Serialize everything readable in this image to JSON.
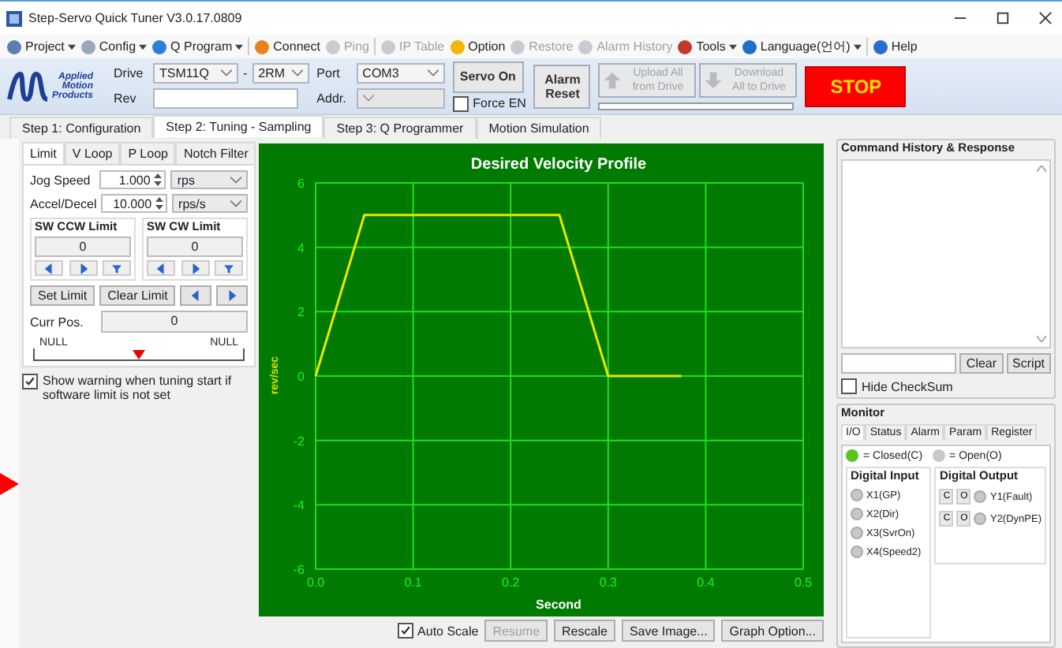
{
  "window": {
    "title": "Step-Servo Quick Tuner V3.0.17.0809"
  },
  "menu": [
    {
      "label": "Project",
      "dropdown": true,
      "disabled": false
    },
    {
      "label": "Config",
      "dropdown": true,
      "disabled": false
    },
    {
      "label": "Q Program",
      "dropdown": true,
      "disabled": false
    },
    {
      "label": "Connect",
      "dropdown": false,
      "disabled": false
    },
    {
      "label": "Ping",
      "dropdown": false,
      "disabled": true
    },
    {
      "label": "IP Table",
      "dropdown": false,
      "disabled": true
    },
    {
      "label": "Option",
      "dropdown": false,
      "disabled": false
    },
    {
      "label": "Restore",
      "dropdown": false,
      "disabled": true
    },
    {
      "label": "Alarm History",
      "dropdown": false,
      "disabled": true
    },
    {
      "label": "Tools",
      "dropdown": true,
      "disabled": false
    },
    {
      "label": "Language(언어)",
      "dropdown": true,
      "disabled": false
    },
    {
      "label": "Help",
      "dropdown": false,
      "disabled": false
    }
  ],
  "ribbon": {
    "logo": [
      "Applied",
      "Motion",
      "Products"
    ],
    "drive_label": "Drive",
    "drive": "TSM11Q",
    "dash": "-",
    "drive_option": "2RM",
    "rev_label": "Rev",
    "port_label": "Port",
    "port": "COM3",
    "addr_label": "Addr.",
    "servo_on": "Servo On",
    "force_en": {
      "label": "Force EN",
      "checked": false
    },
    "alarm_reset": [
      "Alarm",
      "Reset"
    ],
    "upload": {
      "label": [
        "Upload All",
        "from Drive"
      ],
      "disabled": true
    },
    "download": {
      "label": [
        "Download",
        "All to Drive"
      ],
      "disabled": true
    },
    "progress": {
      "level": 0
    },
    "stop": "STOP"
  },
  "tabs": [
    {
      "label": "Step 1: Configuration",
      "selected": false
    },
    {
      "label": "Step 2: Tuning - Sampling",
      "selected": true
    },
    {
      "label": "Step 3: Q Programmer",
      "selected": false
    },
    {
      "label": "Motion Simulation",
      "selected": false
    }
  ],
  "left": {
    "tabs": [
      {
        "label": "Limit",
        "selected": true
      },
      {
        "label": "V Loop",
        "selected": false
      },
      {
        "label": "P Loop",
        "selected": false
      },
      {
        "label": "Notch Filter",
        "selected": false
      }
    ],
    "jog_speed": {
      "label": "Jog Speed",
      "value": "1.000",
      "unit": "rps"
    },
    "accel": {
      "label": "Accel/Decel",
      "value": "10.000",
      "unit": "rps/s"
    },
    "limits": [
      {
        "title": "SW CCW Limit",
        "value": "0"
      },
      {
        "title": "SW CW Limit",
        "value": "0"
      }
    ],
    "set_limit": "Set Limit",
    "clear_limit": "Clear Limit",
    "curr_pos": {
      "label": "Curr Pos.",
      "value": "0"
    },
    "scale": {
      "left": "NULL",
      "right": "NULL",
      "level": 0.5
    },
    "warning": {
      "label": "Show warning when tuning start if software limit is not set",
      "checked": true
    }
  },
  "chart": {
    "chart_data": {
      "type": "line",
      "title": "Desired Velocity Profile",
      "xlabel": "Second",
      "ylabel": "rev/sec",
      "x": [
        0,
        0.05,
        0.25,
        0.3,
        0.375
      ],
      "grid": true,
      "series": [
        {
          "color": "#e8e800",
          "values": [
            0,
            5,
            5,
            0,
            0
          ]
        }
      ],
      "xlim": [
        0,
        0.5
      ],
      "ylim": [
        -6,
        6
      ],
      "xticks": [
        {
          "value": 0,
          "label": "0.0"
        },
        {
          "value": 0.1,
          "label": "0.1"
        },
        {
          "value": 0.2,
          "label": "0.2"
        },
        {
          "value": 0.3,
          "label": "0.3"
        },
        {
          "value": 0.4,
          "label": "0.4"
        },
        {
          "value": 0.5,
          "label": "0.5"
        }
      ],
      "yticks": [
        -6,
        -4,
        -2,
        0,
        2,
        4,
        6
      ]
    },
    "auto_scale": {
      "label": "Auto Scale",
      "checked": true
    },
    "buttons": [
      {
        "label": "Resume",
        "disabled": true
      },
      {
        "label": "Rescale",
        "disabled": false
      },
      {
        "label": "Save Image...",
        "disabled": false
      },
      {
        "label": "Graph Option...",
        "disabled": false
      }
    ]
  },
  "command": {
    "title": "Command History & Response",
    "clear": "Clear",
    "script": "Script",
    "hide_checksum": {
      "label": "Hide CheckSum",
      "checked": false
    }
  },
  "monitor": {
    "title": "Monitor",
    "tabs": [
      {
        "label": "I/O",
        "selected": true
      },
      {
        "label": "Status",
        "selected": false
      },
      {
        "label": "Alarm",
        "selected": false
      },
      {
        "label": "Param",
        "selected": false
      },
      {
        "label": "Register",
        "selected": false
      }
    ],
    "legend": [
      {
        "label": "= Closed(C)",
        "color": "#5cc41e"
      },
      {
        "label": "= Open(O)",
        "color": "#c8c8c8"
      }
    ],
    "inputs_title": "Digital Input",
    "inputs": [
      {
        "label": "X1(GP)",
        "on": false
      },
      {
        "label": "X2(Dir)",
        "on": false
      },
      {
        "label": "X3(SvrOn)",
        "on": false
      },
      {
        "label": "X4(Speed2)",
        "on": false
      }
    ],
    "outputs_title": "Digital Output",
    "outputs": [
      {
        "label": "Y1(Fault)",
        "on": false,
        "close": "C",
        "open": "O"
      },
      {
        "label": "Y2(DynPE)",
        "on": false,
        "close": "C",
        "open": "O"
      }
    ]
  }
}
